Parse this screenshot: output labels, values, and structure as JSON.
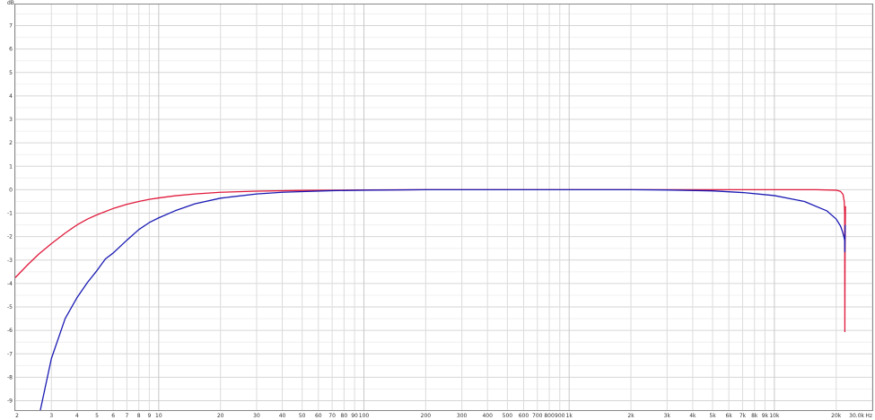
{
  "chart_data": {
    "type": "line",
    "title": "",
    "xscale": "log",
    "xlim": [
      2,
      30000
    ],
    "ylim": [
      -9.4,
      7.9
    ],
    "grid": true,
    "y_unit_label": "dB",
    "x_unit_label": "Hz",
    "y_ticks": [
      7,
      6,
      5,
      4,
      3,
      2,
      1,
      0,
      -1,
      -2,
      -3,
      -4,
      -5,
      -6,
      -7,
      -8,
      -9
    ],
    "x_ticks": [
      {
        "v": 2,
        "label": "2"
      },
      {
        "v": 3,
        "label": "3"
      },
      {
        "v": 4,
        "label": "4"
      },
      {
        "v": 5,
        "label": "5"
      },
      {
        "v": 6,
        "label": "6"
      },
      {
        "v": 7,
        "label": "7"
      },
      {
        "v": 8,
        "label": "8"
      },
      {
        "v": 9,
        "label": "9"
      },
      {
        "v": 10,
        "label": "10"
      },
      {
        "v": 20,
        "label": "20"
      },
      {
        "v": 30,
        "label": "30"
      },
      {
        "v": 40,
        "label": "40"
      },
      {
        "v": 50,
        "label": "50"
      },
      {
        "v": 60,
        "label": "60"
      },
      {
        "v": 70,
        "label": "70"
      },
      {
        "v": 80,
        "label": "80"
      },
      {
        "v": 90,
        "label": "90"
      },
      {
        "v": 100,
        "label": "100"
      },
      {
        "v": 200,
        "label": "200"
      },
      {
        "v": 300,
        "label": "300"
      },
      {
        "v": 400,
        "label": "400"
      },
      {
        "v": 500,
        "label": "500"
      },
      {
        "v": 600,
        "label": "600"
      },
      {
        "v": 700,
        "label": "700"
      },
      {
        "v": 800,
        "label": "800"
      },
      {
        "v": 900,
        "label": "900"
      },
      {
        "v": 1000,
        "label": "1k"
      },
      {
        "v": 2000,
        "label": "2k"
      },
      {
        "v": 3000,
        "label": "3k"
      },
      {
        "v": 4000,
        "label": "4k"
      },
      {
        "v": 5000,
        "label": "5k"
      },
      {
        "v": 6000,
        "label": "6k"
      },
      {
        "v": 7000,
        "label": "7k"
      },
      {
        "v": 8000,
        "label": "8k"
      },
      {
        "v": 9000,
        "label": "9k"
      },
      {
        "v": 10000,
        "label": "10k"
      },
      {
        "v": 20000,
        "label": "20k"
      },
      {
        "v": 30000,
        "label": "30.0k"
      }
    ],
    "series": [
      {
        "color": "#e01a3c",
        "points": [
          [
            2,
            -3.75
          ],
          [
            2.3,
            -3.2
          ],
          [
            2.6,
            -2.75
          ],
          [
            3,
            -2.3
          ],
          [
            3.5,
            -1.85
          ],
          [
            4,
            -1.5
          ],
          [
            4.5,
            -1.25
          ],
          [
            5,
            -1.07
          ],
          [
            6,
            -0.8
          ],
          [
            7,
            -0.62
          ],
          [
            8,
            -0.5
          ],
          [
            9,
            -0.41
          ],
          [
            10,
            -0.35
          ],
          [
            12,
            -0.26
          ],
          [
            15,
            -0.18
          ],
          [
            20,
            -0.11
          ],
          [
            30,
            -0.06
          ],
          [
            50,
            -0.03
          ],
          [
            100,
            -0.01
          ],
          [
            200,
            0
          ],
          [
            1000,
            0
          ],
          [
            5000,
            0
          ],
          [
            10000,
            0
          ],
          [
            16000,
            0
          ],
          [
            20000,
            -0.02
          ],
          [
            21000,
            -0.07
          ],
          [
            21600,
            -0.2
          ],
          [
            21900,
            -0.5
          ],
          [
            22000,
            -1.0
          ],
          [
            22050,
            -6.05
          ],
          [
            22100,
            -2.5
          ],
          [
            22200,
            -0.7
          ]
        ]
      },
      {
        "color": "#1a1ab4",
        "points": [
          [
            2.65,
            -9.4
          ],
          [
            3,
            -7.2
          ],
          [
            3.5,
            -5.5
          ],
          [
            4,
            -4.6
          ],
          [
            4.5,
            -3.95
          ],
          [
            5,
            -3.45
          ],
          [
            5.5,
            -2.95
          ],
          [
            6,
            -2.7
          ],
          [
            7,
            -2.15
          ],
          [
            8,
            -1.7
          ],
          [
            9,
            -1.4
          ],
          [
            10,
            -1.2
          ],
          [
            12,
            -0.9
          ],
          [
            15,
            -0.6
          ],
          [
            20,
            -0.36
          ],
          [
            30,
            -0.18
          ],
          [
            40,
            -0.11
          ],
          [
            50,
            -0.08
          ],
          [
            70,
            -0.04
          ],
          [
            100,
            -0.02
          ],
          [
            200,
            0
          ],
          [
            1000,
            0
          ],
          [
            2000,
            0
          ],
          [
            3000,
            -0.01
          ],
          [
            5000,
            -0.05
          ],
          [
            7000,
            -0.12
          ],
          [
            10000,
            -0.25
          ],
          [
            14000,
            -0.5
          ],
          [
            18000,
            -0.9
          ],
          [
            20000,
            -1.25
          ],
          [
            21000,
            -1.55
          ],
          [
            21500,
            -1.8
          ],
          [
            21800,
            -2.0
          ],
          [
            22000,
            -2.15
          ],
          [
            22050,
            -2.65
          ],
          [
            22100,
            -1.7
          ],
          [
            22150,
            -1.5
          ]
        ]
      }
    ]
  }
}
